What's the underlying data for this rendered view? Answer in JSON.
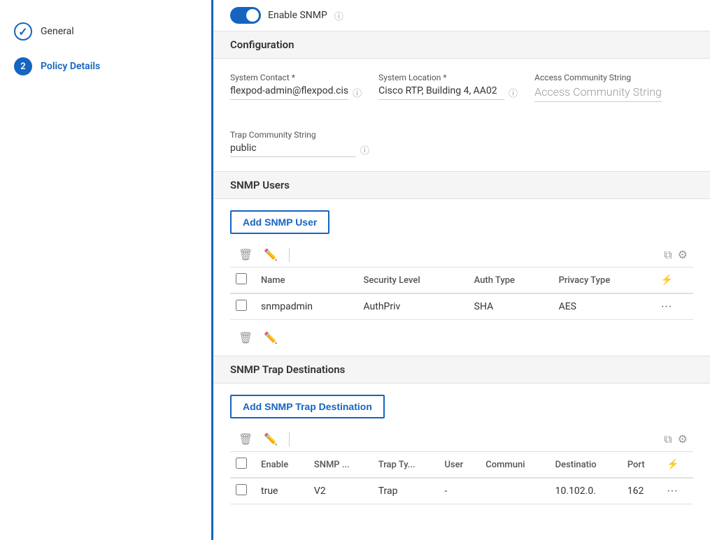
{
  "sidebar": {
    "items": [
      {
        "id": "general",
        "step": "✓",
        "label": "General",
        "state": "completed"
      },
      {
        "id": "policy-details",
        "step": "2",
        "label": "Policy Details",
        "state": "active"
      }
    ]
  },
  "enable_snmp": {
    "label": "Enable SNMP",
    "enabled": true
  },
  "configuration": {
    "section_title": "Configuration",
    "system_contact": {
      "label": "System Contact *",
      "value": "flexpod-admin@flexpod.cis"
    },
    "system_location": {
      "label": "System Location *",
      "value": "Cisco RTP, Building 4, AA02"
    },
    "access_community_string": {
      "label": "Access Community String"
    },
    "trap_community_string": {
      "label": "Trap Community String",
      "value": "public"
    }
  },
  "snmp_users": {
    "section_title": "SNMP Users",
    "add_button": "Add SNMP User",
    "columns": [
      "Name",
      "Security Level",
      "Auth Type",
      "Privacy Type"
    ],
    "rows": [
      {
        "name": "snmpadmin",
        "security_level": "AuthPriv",
        "auth_type": "SHA",
        "privacy_type": "AES"
      }
    ]
  },
  "snmp_trap_destinations": {
    "section_title": "SNMP Trap Destinations",
    "add_button": "Add SNMP Trap Destination",
    "columns": [
      "Enable",
      "SNMP ...",
      "Trap Ty...",
      "User",
      "Communi",
      "Destinatio",
      "Port"
    ],
    "rows": [
      {
        "enable": "true",
        "snmp_version": "V2",
        "trap_type": "Trap",
        "user": "-",
        "community": "",
        "destination": "10.102.0.",
        "port": "162"
      }
    ]
  }
}
